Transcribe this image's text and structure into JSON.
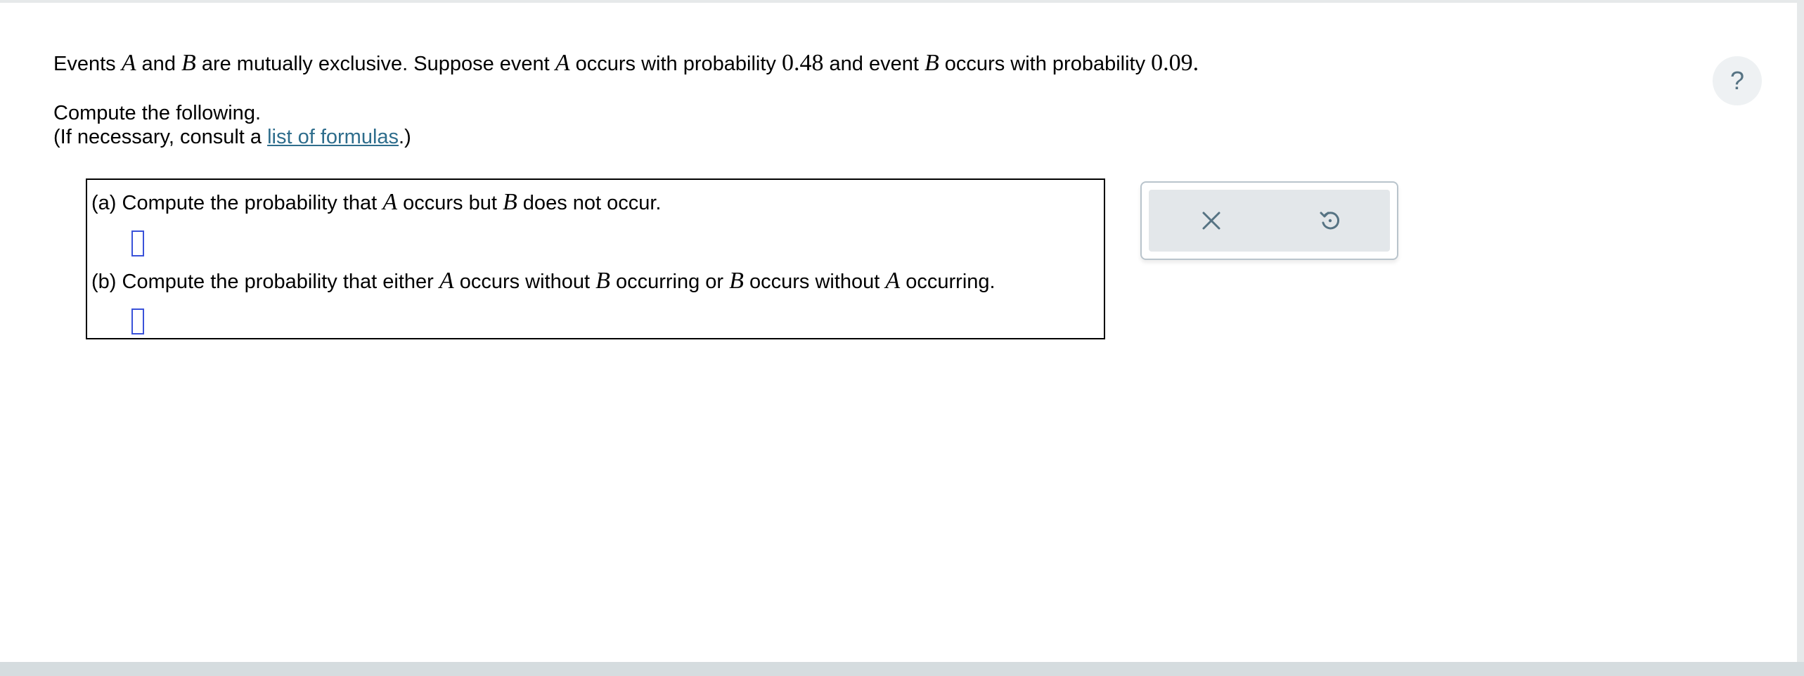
{
  "problem": {
    "p1": "Events ",
    "varA": "A",
    "p2": " and ",
    "varB": "B",
    "p3": " are mutually exclusive. Suppose event ",
    "p4": " occurs with probability ",
    "probA": "0.48",
    "p5": " and event ",
    "probB": "0.09",
    "end": "."
  },
  "instructions": {
    "compute": "Compute the following.",
    "consult_prefix": "(If necessary, consult a ",
    "link_label": "list of formulas",
    "consult_suffix": ".)"
  },
  "part_a": {
    "prefix": "(a) Compute the probability that ",
    "middle": " occurs but ",
    "suffix": " does not occur."
  },
  "part_b": {
    "prefix": "(b) Compute the probability that either ",
    "mid1": " occurs without ",
    "mid2": " occurring or ",
    "mid3": " occurs without ",
    "suffix": " occurring."
  },
  "answers": {
    "a_value": "",
    "b_value": ""
  },
  "tools": {
    "clear_icon": "close-icon",
    "undo_icon": "undo-icon"
  },
  "help": {
    "label": "?"
  },
  "colors": {
    "link": "#2e6d8c",
    "input_border": "#3a52d9",
    "panel_bg": "#e3e7ea",
    "icon": "#567383"
  }
}
